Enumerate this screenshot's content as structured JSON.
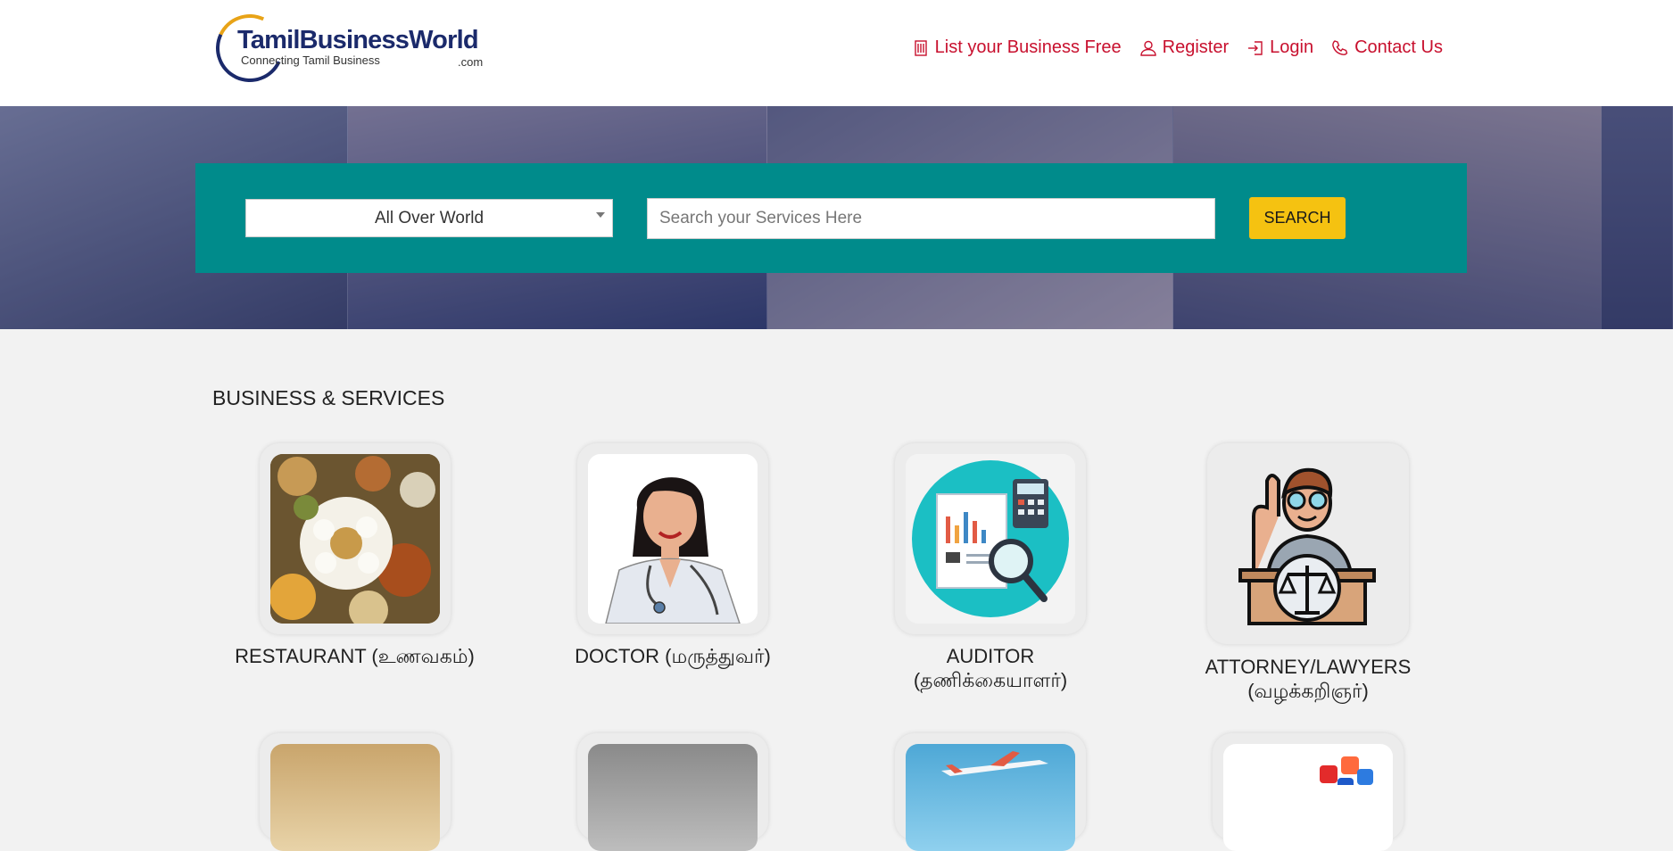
{
  "logo": {
    "brand": "TamilBusinessWorld",
    "tagline": "Connecting Tamil Business",
    "dotcom": ".com"
  },
  "nav": {
    "list_business": "List your Business Free",
    "register": "Register",
    "login": "Login",
    "contact": "Contact Us"
  },
  "search": {
    "location": "All Over World",
    "placeholder": "Search your Services Here",
    "button": "SEARCH"
  },
  "section": {
    "title": "BUSINESS & SERVICES"
  },
  "categories": [
    {
      "line1": "RESTAURANT (உணவகம்)",
      "line2": ""
    },
    {
      "line1": "DOCTOR (மருத்துவர்)",
      "line2": ""
    },
    {
      "line1": "AUDITOR",
      "line2": "(தணிக்கையாளர்)"
    },
    {
      "line1": "ATTORNEY/LAWYERS",
      "line2": "(வழக்கறிஞர்)"
    }
  ],
  "colors": {
    "accent": "#c8102e",
    "teal": "#008b8b",
    "button": "#f5c211",
    "brand": "#1b2a6b"
  }
}
